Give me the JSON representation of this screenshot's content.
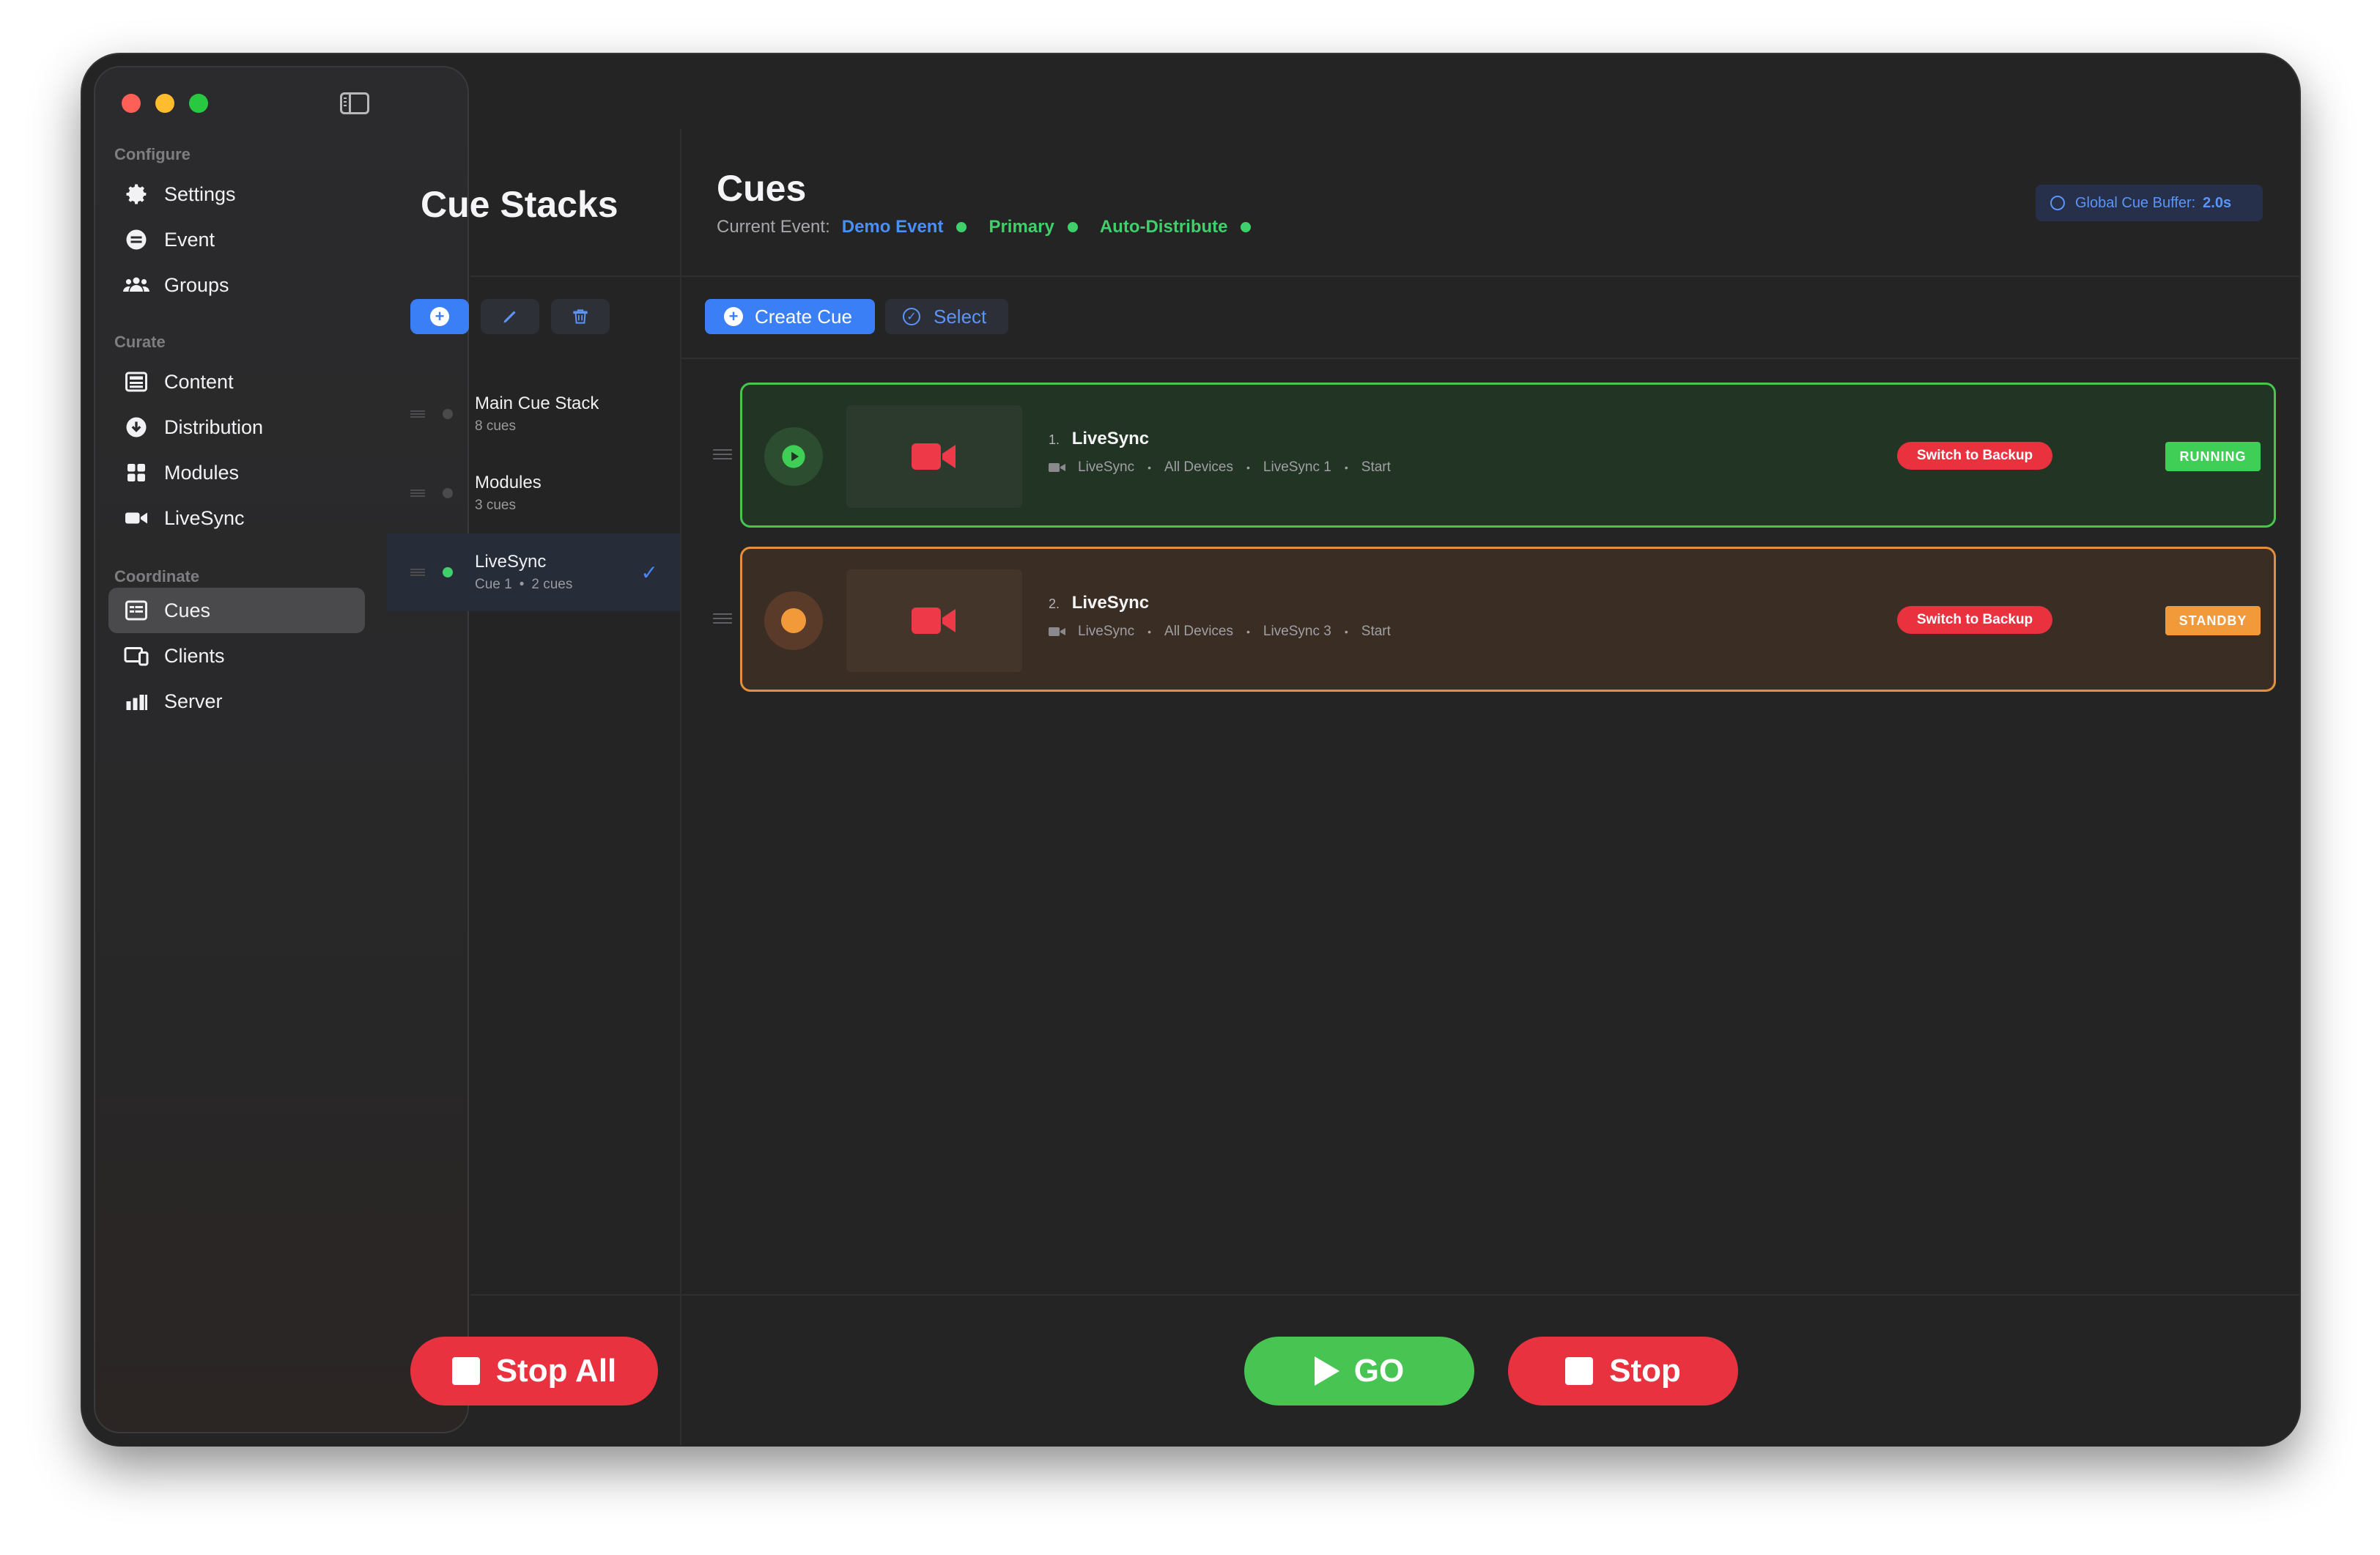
{
  "sidebar": {
    "sections": [
      {
        "label": "Configure",
        "items": [
          {
            "label": "Settings",
            "icon": "gear-icon"
          },
          {
            "label": "Event",
            "icon": "event-icon"
          },
          {
            "label": "Groups",
            "icon": "groups-icon"
          }
        ]
      },
      {
        "label": "Curate",
        "items": [
          {
            "label": "Content",
            "icon": "content-icon"
          },
          {
            "label": "Distribution",
            "icon": "distribution-icon"
          },
          {
            "label": "Modules",
            "icon": "modules-icon"
          },
          {
            "label": "LiveSync",
            "icon": "video-camera-icon"
          }
        ]
      },
      {
        "label": "Coordinate",
        "items": [
          {
            "label": "Cues",
            "icon": "cues-icon",
            "active": true
          },
          {
            "label": "Clients",
            "icon": "clients-icon"
          },
          {
            "label": "Server",
            "icon": "server-icon"
          }
        ]
      }
    ]
  },
  "stacks": {
    "title": "Cue Stacks",
    "items": [
      {
        "name": "Main Cue Stack",
        "sub": "8 cues",
        "dot_color": "#4a4a4d"
      },
      {
        "name": "Modules",
        "sub": "3 cues",
        "dot_color": "#4a4a4d"
      },
      {
        "name": "LiveSync",
        "sub_cue": "Cue 1",
        "sub_count": "2 cues",
        "dot_color": "#3fd06c",
        "selected": true
      }
    ],
    "stop_all_label": "Stop All"
  },
  "cues": {
    "title": "Cues",
    "current_event_label": "Current Event:",
    "event_name": "Demo Event",
    "primary_label": "Primary",
    "auto_distribute_label": "Auto-Distribute",
    "buffer_label": "Global Cue Buffer:",
    "buffer_value": "2.0s",
    "create_label": "Create Cue",
    "select_label": "Select",
    "list": [
      {
        "number": "1.",
        "name": "LiveSync",
        "type": "LiveSync",
        "target": "All Devices",
        "source": "LiveSync 1",
        "action": "Start",
        "switch_label": "Switch to Backup",
        "status": "RUNNING"
      },
      {
        "number": "2.",
        "name": "LiveSync",
        "type": "LiveSync",
        "target": "All Devices",
        "source": "LiveSync 3",
        "action": "Start",
        "switch_label": "Switch to Backup",
        "status": "STANDBY"
      }
    ],
    "go_label": "GO",
    "stop_label": "Stop"
  },
  "colors": {
    "accent_blue": "#3a7ff6",
    "running_green": "#47c64e",
    "standby_orange": "#e48f3c",
    "stop_red": "#e8323f"
  }
}
